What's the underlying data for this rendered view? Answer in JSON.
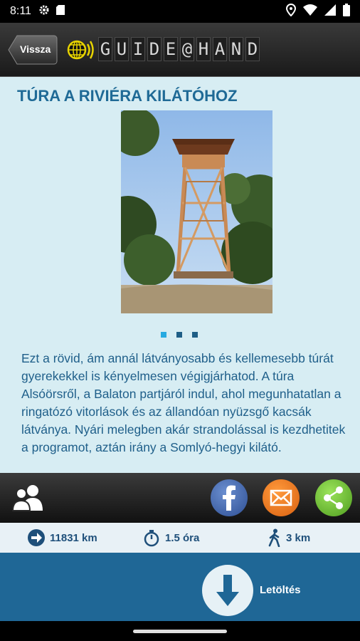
{
  "status_bar": {
    "time": "8:11",
    "icons_left": [
      "gear-icon",
      "sd-card-icon"
    ],
    "icons_right": [
      "location-icon",
      "wifi-icon",
      "signal-icon",
      "battery-icon"
    ]
  },
  "header": {
    "back_label": "Vissza",
    "logo_text": "GUIDE@HAND",
    "logo_icon": "globe-sound-icon"
  },
  "content": {
    "title": "TÚRA A RIVIÉRA KILÁTÓHOZ",
    "photo": "lookout-tower-photo",
    "carousel": {
      "count": 3,
      "active": 0
    },
    "description": "Ezt a rövid, ám annál látványosabb és kellemesebb túrát gyerekekkel is kényelmesen végigjárhatod. A túra Alsóörsről, a Balaton partjáról indul, ahol megunhatatlan a ringatózó vitorlások és az állandóan nyüzsgő kacsák látványa. Nyári melegben akár strandolással is kezdhetitek a programot, aztán irány a Somlyó-hegyi kilátó."
  },
  "social": {
    "buttons": [
      "facebook",
      "email",
      "share"
    ],
    "colors": {
      "facebook": "#3b5998",
      "email": "#f07d1f",
      "share": "#6cc233"
    }
  },
  "stats": {
    "distance_to": "11831 km",
    "duration": "1.5 óra",
    "length": "3 km"
  },
  "download": {
    "label": "Letöltés"
  },
  "colors": {
    "title": "#1f6a96",
    "body_text": "#1f5f8a",
    "content_bg": "#d7edf3",
    "download_bar": "#1f6796",
    "dot_active": "#27aae1"
  }
}
